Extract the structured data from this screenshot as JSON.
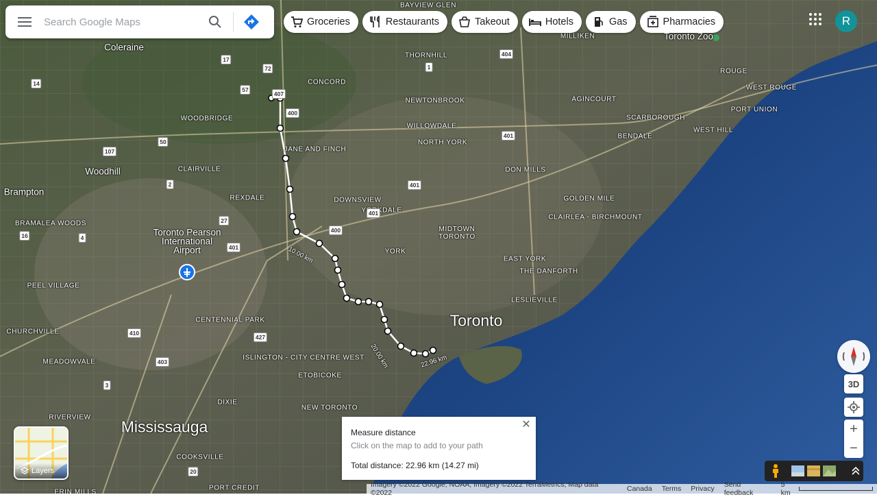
{
  "search": {
    "placeholder": "Search Google Maps"
  },
  "chips": [
    {
      "label": "Groceries",
      "icon": "cart-icon"
    },
    {
      "label": "Restaurants",
      "icon": "fork-knife-icon"
    },
    {
      "label": "Takeout",
      "icon": "takeout-icon"
    },
    {
      "label": "Hotels",
      "icon": "bed-icon"
    },
    {
      "label": "Gas",
      "icon": "gas-pump-icon"
    },
    {
      "label": "Pharmacies",
      "icon": "pharmacy-icon"
    }
  ],
  "account": {
    "initial": "R",
    "color": "#12939a"
  },
  "map": {
    "places": {
      "toronto": "Toronto",
      "mississauga": "Mississauga",
      "brampton": "Brampton",
      "north_york": "NORTH YORK",
      "scarborough": "SCARBOROUGH",
      "york": "YORK",
      "east_york": "EAST YORK",
      "etobicoke": "ETOBICOKE",
      "bayview_glen": "BAYVIEW GLEN",
      "coleraine": "Coleraine",
      "thornhill": "THORNHILL",
      "concord": "CONCORD",
      "woodbridge": "WOODBRIDGE",
      "jane_and_finch": "JANE AND FINCH",
      "newtonbrook": "NEWTONBROOK",
      "willowdale": "WILLOWDALE",
      "agincourt": "AGINCOURT",
      "milliken": "MILLIKEN",
      "rouge": "ROUGE",
      "west_rouge": "WEST ROUGE",
      "port_union": "PORT UNION",
      "west_hill": "WEST HILL",
      "bendale": "BENDALE",
      "don_mills": "DON MILLS",
      "woodhill": "Woodhill",
      "clairville": "CLAIRVILLE",
      "rexdale": "REXDALE",
      "downsview": "DOWNSVIEW",
      "yorkdale": "YORKDALE",
      "midtown_toronto": "MIDTOWN TORONTO",
      "golden_mile": "GOLDEN MILE",
      "clairlea_birchmount": "CLAIRLEA - BIRCHMOUNT",
      "the_danforth": "THE DANFORTH",
      "leslieville": "LESLIEVILLE",
      "bramalea_woods": "BRAMALEA WOODS",
      "pearson": "Toronto Pearson International Airport",
      "peel_village": "PEEL VILLAGE",
      "centennial_park": "CENTENNIAL PARK",
      "churchville": "CHURCHVILLE",
      "islington_city_centre_west": "ISLINGTON - CITY CENTRE WEST",
      "meadowvale": "MEADOWVALE",
      "dixie": "DIXIE",
      "new_toronto": "NEW TORONTO",
      "riverview": "RIVERVIEW",
      "cooksville": "COOKSVILLE",
      "port_credit": "PORT CREDIT",
      "erin_mills": "ERIN MILLS",
      "toronto_zoo": "Toronto Zoo"
    },
    "highways": [
      "400",
      "401",
      "407",
      "427",
      "409",
      "404",
      "410",
      "403",
      "1",
      "2",
      "4",
      "5",
      "7",
      "16",
      "14",
      "17",
      "27",
      "50",
      "57",
      "72",
      "73",
      "107",
      "3",
      "20"
    ],
    "measure_labels": [
      "10.00 km",
      "20.00 km",
      "22.96 km"
    ]
  },
  "measure": {
    "title": "Measure distance",
    "hint": "Click on the map to add to your path",
    "total": "Total distance: 22.96 km (14.27 mi)"
  },
  "layers": {
    "label": "Layers"
  },
  "controls": {
    "three_d": "3D"
  },
  "footer": {
    "imagery": "Imagery ©2022 Google, NOAA, Imagery ©2022 TerraMetrics, Map data ©2022",
    "country": "Canada",
    "terms": "Terms",
    "privacy": "Privacy",
    "feedback": "Send feedback",
    "scale": "5 km"
  }
}
